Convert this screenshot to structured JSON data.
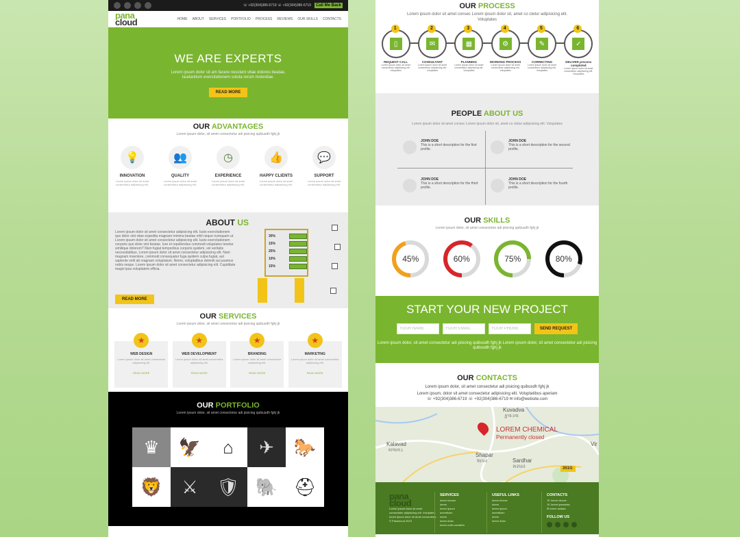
{
  "left": {
    "topbar": {
      "phones": "☏ +92(304)386-6719   ☏ +92(304)386-6719",
      "call_label": "Call Me Back"
    },
    "logo": {
      "top": "pana",
      "bottom": "cloud"
    },
    "nav": [
      "HOME",
      "ABOUT",
      "SERVICES",
      "PORTFOLIO",
      "PROCESS",
      "REVIEWS",
      "OUR SKILLS",
      "CONTACTS"
    ],
    "hero": {
      "title": "WE ARE EXPERTS",
      "text": "Lorem ipsum dolor sit am facere nescient vitae dolores beatae, laudantium exercitationem soluta rerum molestiae.",
      "button": "READ MORE"
    },
    "advantages": {
      "title_a": "OUR",
      "title_b": "ADVANTAGES",
      "subtitle": "Lorem ipsum dolor, sit amet consectetur adi pisicing quibusdh fghj jk",
      "items": [
        {
          "label": "INNOVATION",
          "text": "Lorem ipsum dolor sit amet consectetur adipisicing elit."
        },
        {
          "label": "QUALITY",
          "text": "Lorem ipsum dolor sit amet consectetur adipisicing elit."
        },
        {
          "label": "EXPERIENCE",
          "text": "Lorem ipsum dolor sit amet consectetur adipisicing elit."
        },
        {
          "label": "HAPPY CLIENTS",
          "text": "Lorem ipsum dolor sit amet consectetur adipisicing elit."
        },
        {
          "label": "SUPPORT",
          "text": "Lorem ipsum dolor sit amet consectetur adipisicing elit."
        }
      ]
    },
    "about": {
      "title_a": "ABOUT",
      "title_b": "US",
      "para": "Lorem ipsum dolor sit amet consectetur adipisicing elit. Iusto exercitationem quo dolor sint vitae expedita magnam minima beatae nihil neque numquam ut. Lorem ipsum dolor sit amet consectetur adipisicing elit. Iusto exercitationem corporis quo dolor sint beatae. Iure et repellendus commodi voluptates tenetur similique dolorem? Illum fugiat temporibus corporis quidem, vel veritatis necessitatibus. Lorem ipsum dolor sit amet consectetur adipisicing elit. Nam magnam inventore, commodi consequatur fuga quidem culpa fugiat, aut sapiente velit ab magnam voluptatum. Nemo, voluptatibus deleniti accusamus nobis neque. Lorem ipsum dolor sit amet consectetur adipisicing elit. Cupiditate magni ipsa voluptatem officia.",
      "button": "READ MORE",
      "percents": [
        "30%",
        "15%",
        "25%",
        "10%",
        "15%"
      ]
    },
    "services": {
      "title_a": "OUR",
      "title_b": "SERVICES",
      "subtitle": "Lorem ipsum dolor, sit amet consectetur adi pisicing quibusdh fghj jk",
      "items": [
        {
          "title": "WEB DESIGN",
          "text": "Lorem ipsum dolor sit amet consectetur adipisicing elit.",
          "more": "READ MORE"
        },
        {
          "title": "WEB DEVELOPMENT",
          "text": "Lorem ipsum dolor sit amet consectetur adipisicing elit.",
          "more": "READ MORE"
        },
        {
          "title": "BRANDING",
          "text": "Lorem ipsum dolor sit amet consectetur adipisicing elit.",
          "more": "READ MORE"
        },
        {
          "title": "MARKETING",
          "text": "Lorem ipsum dolor sit amet consectetur adipisicing elit.",
          "more": "READ MORE"
        }
      ]
    },
    "portfolio": {
      "title_a": "OUR",
      "title_b": "PORTFOLIO",
      "subtitle": "Lorem ipsum dolor, sit amet consectetur adi pisicing quibusdh fghj jk",
      "tiles": [
        "♛",
        "🦅",
        "⌂",
        "✈",
        "🐎",
        "🦁",
        "⚔",
        "🛡",
        "🐘",
        "⛑"
      ]
    }
  },
  "right": {
    "process": {
      "title_a": "OUR",
      "title_b": "PROCESS",
      "subtitle": "Lorem ipsum dolor sit amet consec Lorem ipsum dolor sit, amet co ctetur adipisicing elit. Voluptates",
      "steps": [
        {
          "num": "1",
          "icon": "▯",
          "title": "REQUEST CALL",
          "text": "Lorem ipsum dolor sit amet consectetur adipisicing elit. Voluptates"
        },
        {
          "num": "2",
          "icon": "✉",
          "title": "CONSULTANT",
          "text": "Lorem ipsum dolor sit amet consectetur adipisicing elit. Voluptates"
        },
        {
          "num": "3",
          "icon": "▦",
          "title": "PLANNING",
          "text": "Lorem ipsum dolor sit amet consectetur adipisicing elit. Voluptates"
        },
        {
          "num": "4",
          "icon": "⚙",
          "title": "WORKING PROCESS",
          "text": "Lorem ipsum dolor sit amet consectetur adipisicing elit. Voluptates"
        },
        {
          "num": "5",
          "icon": "✎",
          "title": "CORRECTING",
          "text": "Lorem ipsum dolor sit amet consectetur adipisicing elit. Voluptates"
        },
        {
          "num": "6",
          "icon": "✓",
          "title": "DELIVER process completed",
          "text": "Lorem ipsum dolor sit amet consectetur adipisicing elit. Voluptates"
        }
      ]
    },
    "people": {
      "title_a": "PEOPLE",
      "title_b": "ABOUT US",
      "subtitle": "Lorem ipsum dolor sit amet consec Lorem ipsum dolor sit, amet co ctetur adipisicing elit. Voluptates",
      "items": [
        {
          "name": "JOHN DOE",
          "desc": "This is a short description for the first profile."
        },
        {
          "name": "JOHN DOE",
          "desc": "This is a short description for the second profile."
        },
        {
          "name": "JOHN DOE",
          "desc": "This is a short description for the third profile."
        },
        {
          "name": "JOHN DOE",
          "desc": "This is a short description for the fourth profile."
        }
      ]
    },
    "skills": {
      "title_a": "OUR",
      "title_b": "SKILLS",
      "subtitle": "Lorem ipsum dolor, sit amet consectetur adi pisicing quibusdh fghj jk",
      "items": [
        {
          "value": 45,
          "label": "45%",
          "color": "#f2a01c"
        },
        {
          "value": 60,
          "label": "60%",
          "color": "#d7262a"
        },
        {
          "value": 75,
          "label": "75%",
          "color": "#7ab52f"
        },
        {
          "value": 80,
          "label": "80%",
          "color": "#111111"
        }
      ]
    },
    "cta": {
      "title": "START YOUR NEW PROJECT",
      "name_ph": "YOUR NAME",
      "email_ph": "YOUR EMAIL",
      "phone_ph": "YOUR PHONE",
      "button": "SEND REQUEST",
      "text": "Lorem ipsum dolor, sit amet consectetur adi pisicing quibusdh fghj jk Lorem ipsum dolor, sit amet consectetur adi pisicing quibusdh fghj jk"
    },
    "contacts": {
      "title_a": "OUR",
      "title_b": "CONTACTS",
      "line1": "Lorem ipsum dolor, sit amet consectetur adi pisicing quibusdh fghj jk",
      "line2": "Lorem ipsum, dolor sit amet consectetur adipisicing elit. Voluptatibus aperiam",
      "line3": "☏ +92(304)386-6719  ☏ +92(304)386-6719  ✉ info@website.com"
    },
    "map": {
      "pin_title": "LOREM CHEMICAL",
      "pin_sub": "Permanently closed",
      "place1": "Kuvadva",
      "place1_g": "કુવાડવા",
      "place2": "Kalavad",
      "place2_g": "કાલાવડ",
      "place3": "Shapar",
      "place3_g": "શાપર",
      "place4": "Sardhar",
      "place4_g": "સરધાર",
      "place5": "Vir",
      "road": "351G"
    },
    "footer": {
      "logo_top": "pana",
      "logo_bottom": "cloud",
      "about": "Lorem ipsum dolor sit amet consectetur adipisicing elit. Voluptates lorem ipsum dolor sit amet consectetur.",
      "copyright": "© Panacloud 2019",
      "services_title": "SERVICES",
      "services": [
        "lorem hizzaa",
        "lorem",
        "lorem ipsum",
        "loremfizhn",
        "lorem",
        "lorem dolor",
        "lorem nufin consitbh"
      ],
      "links_title": "USEFUL LINKS",
      "links": [
        "lorem hinzze",
        "lorem",
        "lorem ipsum",
        "loremfizhn",
        "lorem",
        "lorem dolor"
      ],
      "contacts_title": "CONTACTS",
      "contacts": [
        "☏ lorem hinzze",
        "☏ lorem ipsanstra",
        "✉ lorem dolada"
      ],
      "follow_title": "FOLLOW US"
    }
  }
}
